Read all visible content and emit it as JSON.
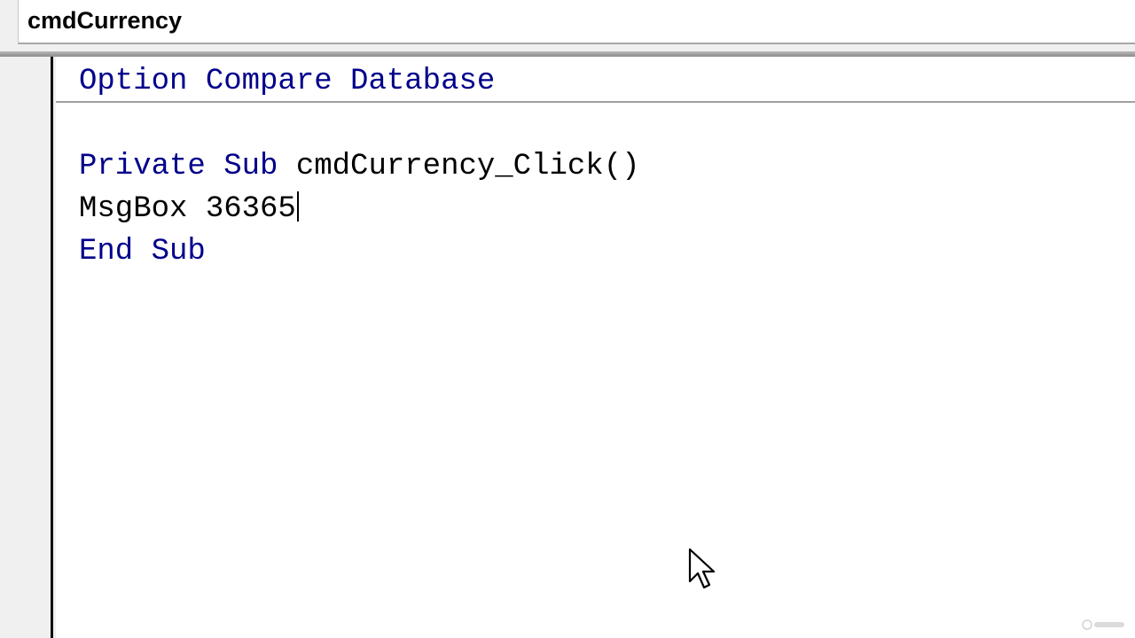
{
  "object_bar": {
    "selected_object": "cmdCurrency"
  },
  "code": {
    "line1": {
      "keyword": "Option Compare Database"
    },
    "line2": {
      "keyword": "Private Sub",
      "rest": " cmdCurrency_Click()"
    },
    "line3": {
      "text": "MsgBox 36365"
    },
    "line4": {
      "keyword": "End Sub"
    }
  },
  "colors": {
    "keyword": "#00008b",
    "text": "#000000"
  },
  "icons": {
    "cursor": "mouse-pointer-icon",
    "watermark": "udemy-logo-icon"
  }
}
